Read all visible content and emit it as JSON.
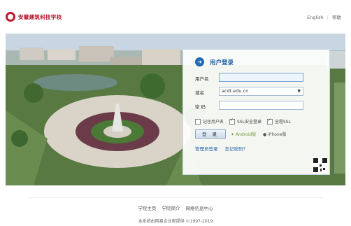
{
  "header": {
    "logo_text": "安徽建筑科技学校",
    "logo_sub": "ANHUI VOCATIONAL COLLEGE OF CONSTRUCTION",
    "lang_link": "English",
    "separator": "|",
    "help_link": "帮助"
  },
  "login": {
    "title": "用户登录",
    "username_label": "用户名",
    "username_value": "",
    "domain_label": "域名",
    "domain_value": "acdt.edu.cn",
    "password_label": "密 码",
    "password_value": "",
    "remember_label": "记住用户名",
    "ssl_label": "SSL安全登录",
    "fullssl_label": "全程SSL",
    "login_button": "登 录",
    "android_label": "Android版",
    "iphone_label": "iPhone版",
    "admin_login": "管理员登录",
    "forgot_password": "忘记密码？"
  },
  "footer": {
    "links": [
      "学院主页",
      "学院简介",
      "网络信息中心"
    ],
    "copyright": "本系统由网易企业邮提供 ©1997-2019"
  },
  "colors": {
    "brand": "#b5122a",
    "accent": "#1b5ea8"
  }
}
